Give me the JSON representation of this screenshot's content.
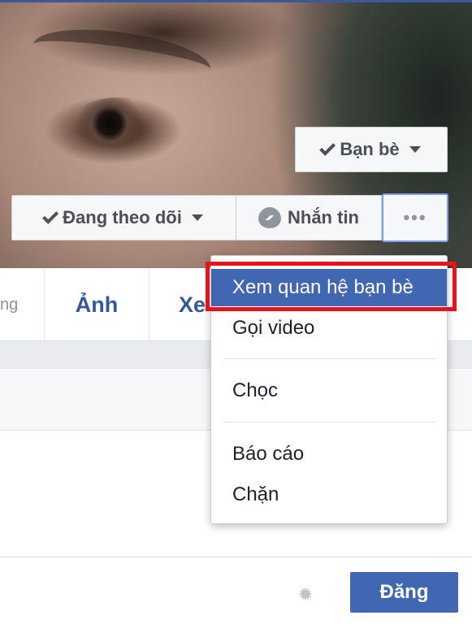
{
  "profile": {
    "friends_label": "Bạn bè",
    "following_label": "Đang theo dõi",
    "message_label": "Nhắn tin",
    "more_label": "•••"
  },
  "tabs": {
    "partial_label": "ng",
    "photos_label": "Ảnh",
    "more_label": "Xe"
  },
  "dropdown": {
    "items": [
      {
        "label": "Xem quan hệ bạn bè",
        "highlighted": true
      },
      {
        "label": "Gọi video"
      },
      {
        "label": "Chọc"
      },
      {
        "label": "Báo cáo"
      },
      {
        "label": "Chặn"
      }
    ]
  },
  "composer": {
    "post_label": "Đăng",
    "settings_icon": "gear-icon"
  },
  "colors": {
    "brand": "#4267b2",
    "link": "#365899",
    "highlight_outline": "#e8121c"
  }
}
